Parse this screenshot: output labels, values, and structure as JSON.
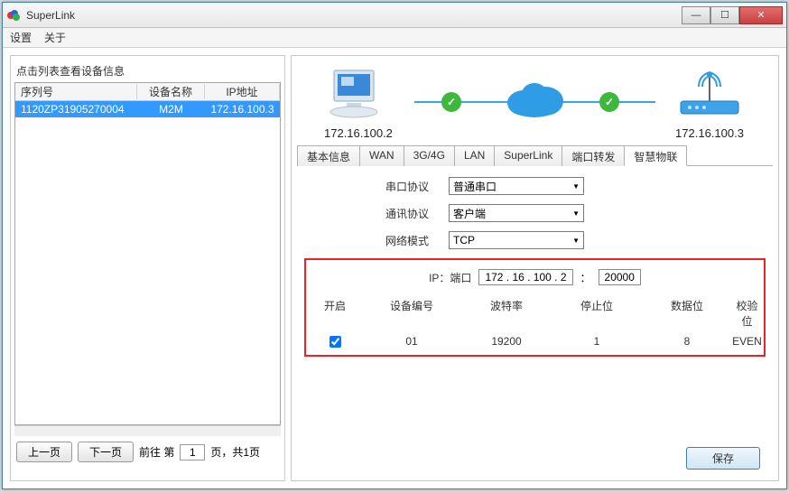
{
  "window": {
    "title": "SuperLink"
  },
  "menu": {
    "settings": "设置",
    "about": "关于"
  },
  "left": {
    "hint": "点击列表查看设备信息",
    "headers": {
      "serial": "序列号",
      "name": "设备名称",
      "ip": "IP地址"
    },
    "row": {
      "serial": "1120ZP31905270004",
      "name": "M2M",
      "ip": "172.16.100.3"
    },
    "pager": {
      "prev": "上一页",
      "next": "下一页",
      "goto": "前往  第",
      "page": "1",
      "total": "页，共1页"
    }
  },
  "diagram": {
    "left_ip": "172.16.100.2",
    "right_ip": "172.16.100.3"
  },
  "tabs": {
    "basic": "基本信息",
    "wan": "WAN",
    "g": "3G/4G",
    "lan": "LAN",
    "superlink": "SuperLink",
    "portfwd": "端口转发",
    "iot": "智慧物联"
  },
  "form": {
    "serial_proto_label": "串口协议",
    "serial_proto_value": "普通串口",
    "comm_proto_label": "通讯协议",
    "comm_proto_value": "客户端",
    "net_mode_label": "网络模式",
    "net_mode_value": "TCP",
    "ip_port_label": "IP：端口",
    "ip_value": "172  .  16  .  100  .   2",
    "port_colon": "：",
    "port_value": "20000"
  },
  "grid": {
    "headers": {
      "enable": "开启",
      "devno": "设备编号",
      "baud": "波特率",
      "stop": "停止位",
      "data": "数据位",
      "parity": "校验位"
    },
    "row": {
      "enable": true,
      "devno": "01",
      "baud": "19200",
      "stop": "1",
      "data": "8",
      "parity": "EVEN"
    }
  },
  "buttons": {
    "save": "保存"
  },
  "icons": {
    "check": "✓",
    "dropdown": "▼",
    "min": "—",
    "max": "☐",
    "close": "✕"
  }
}
